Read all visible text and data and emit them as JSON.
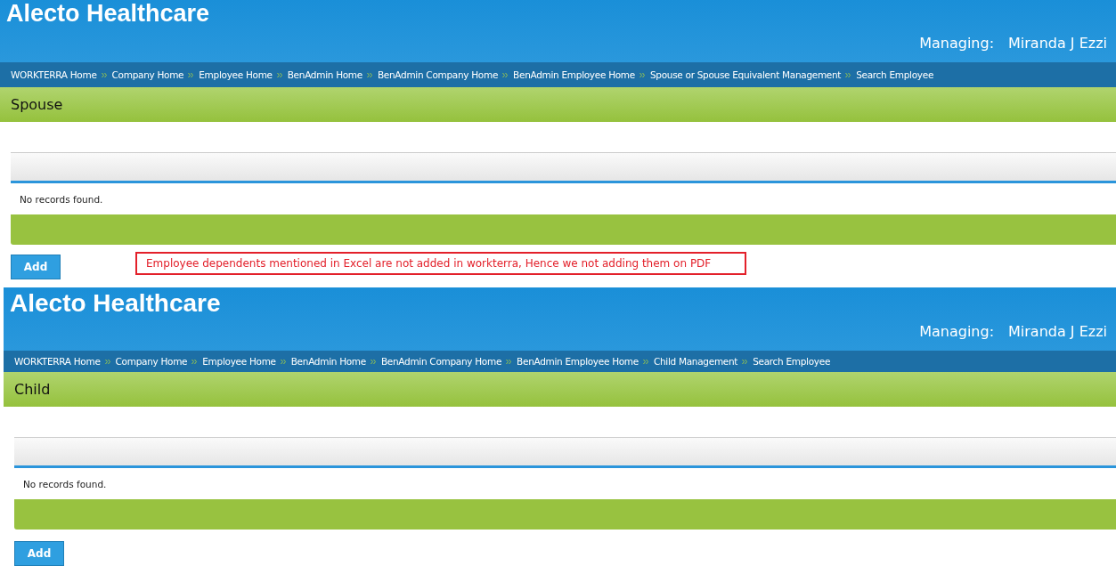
{
  "screens": [
    {
      "company": "Alecto Healthcare",
      "managing_label": "Managing:",
      "managing_name": "Miranda J Ezzi",
      "breadcrumbs": [
        "WORKTERRA Home",
        "Company Home",
        "Employee Home",
        "BenAdmin Home",
        "BenAdmin Company Home",
        "BenAdmin Employee Home",
        "Spouse or Spouse Equivalent Management",
        "Search Employee"
      ],
      "section_title": "Spouse",
      "grid_message": "No records found.",
      "add_button": "Add",
      "note": "Employee dependents mentioned in Excel are not added in workterra, Hence we not adding them on PDF"
    },
    {
      "company": "Alecto Healthcare",
      "managing_label": "Managing:",
      "managing_name": "Miranda J Ezzi",
      "breadcrumbs": [
        "WORKTERRA Home",
        "Company Home",
        "Employee Home",
        "BenAdmin Home",
        "BenAdmin Company Home",
        "BenAdmin Employee Home",
        "Child Management",
        "Search Employee"
      ],
      "section_title": "Child",
      "grid_message": "No records found.",
      "add_button": "Add"
    }
  ]
}
